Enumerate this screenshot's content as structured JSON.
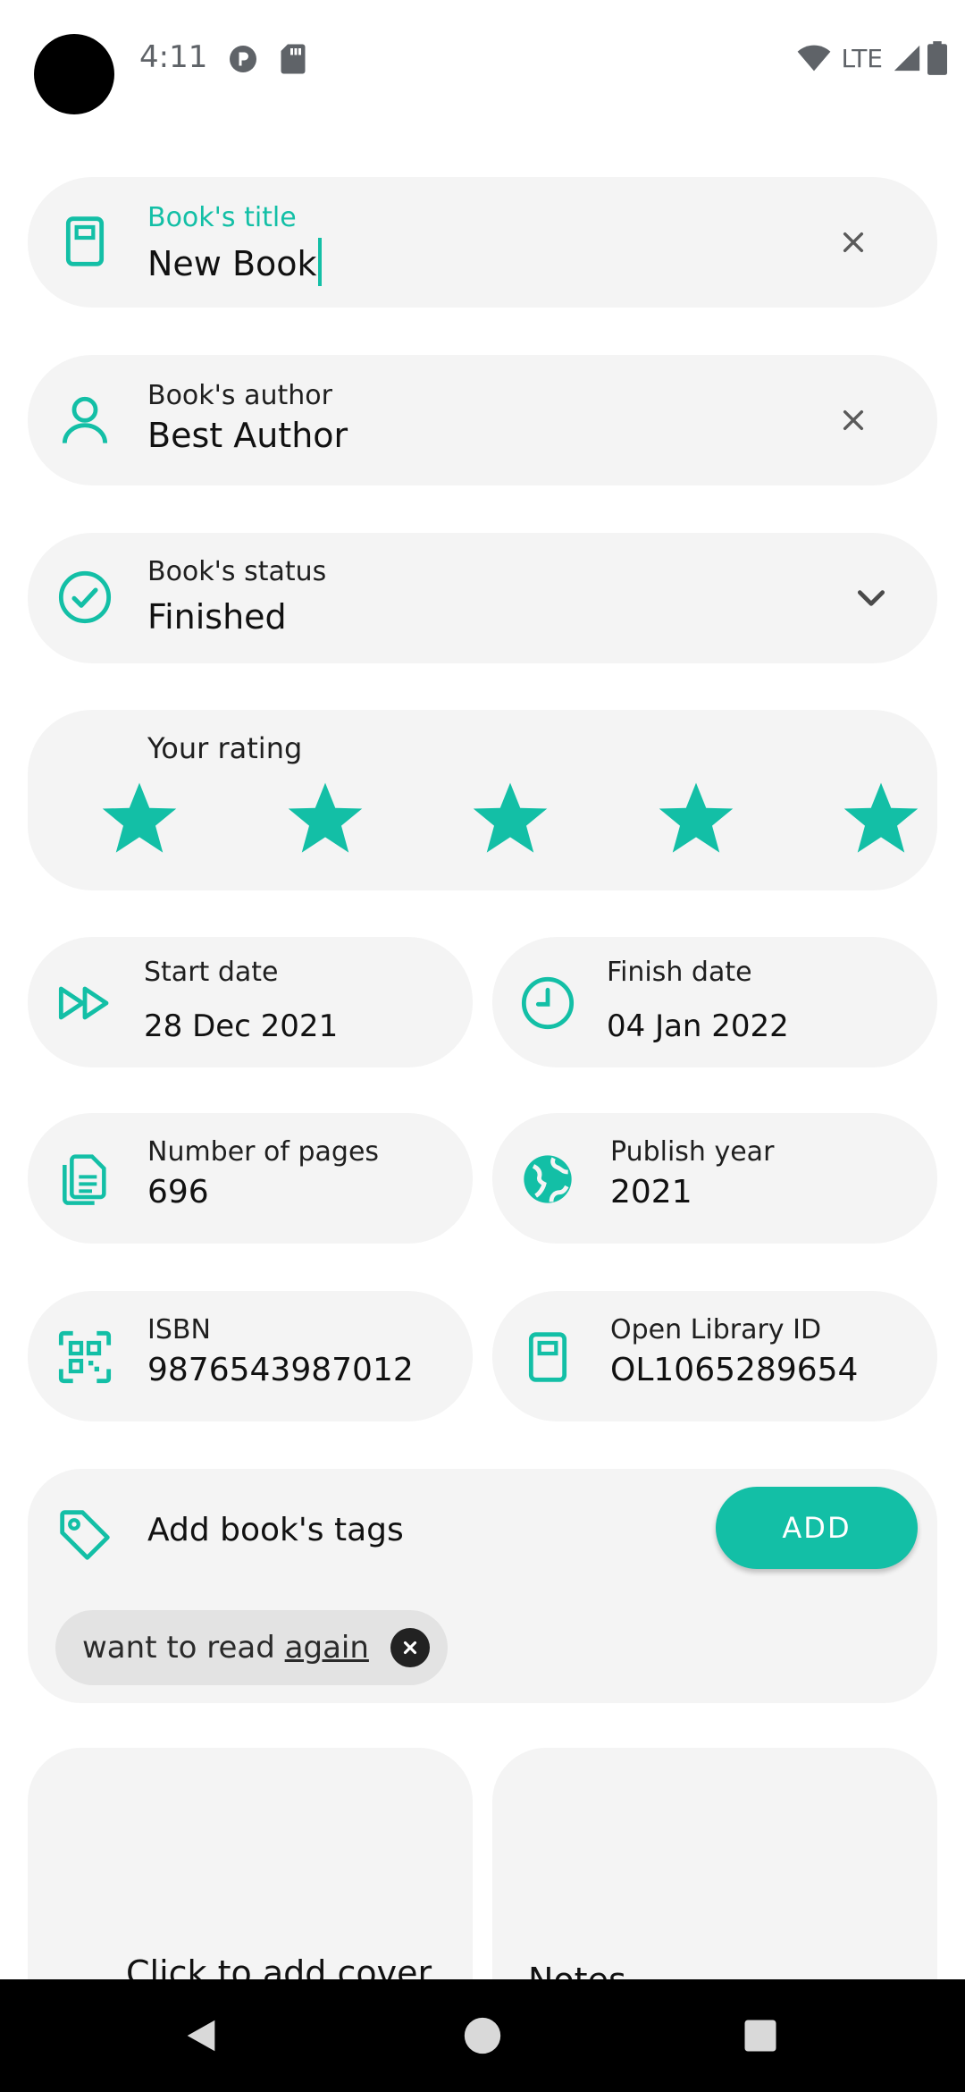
{
  "status_bar": {
    "time": "4:11",
    "network": "LTE",
    "icons": [
      "notification-icon",
      "sd-card-icon",
      "wifi-icon",
      "signal-icon",
      "battery-icon"
    ]
  },
  "colors": {
    "accent": "#13bfa6",
    "card": "#f4f4f4",
    "chip": "#e3e3e3"
  },
  "form": {
    "title": {
      "label": "Book's title",
      "value": "New Book",
      "icon": "book-icon",
      "clear_icon": "close-icon"
    },
    "author": {
      "label": "Book's author",
      "value": "Best Author",
      "icon": "person-icon",
      "clear_icon": "close-icon"
    },
    "status": {
      "label": "Book's status",
      "value": "Finished",
      "icon": "check-circle-icon",
      "dropdown_icon": "chevron-down-icon"
    },
    "rating": {
      "label": "Your rating",
      "value": 5,
      "max": 5,
      "icon": "star-icon"
    },
    "start_date": {
      "label": "Start date",
      "value": "28 Dec 2021",
      "icon": "fast-forward-icon"
    },
    "finish_date": {
      "label": "Finish date",
      "value": "04 Jan 2022",
      "icon": "clock-icon"
    },
    "pages": {
      "label": "Number of pages",
      "value": "696",
      "icon": "pages-icon"
    },
    "publish_year": {
      "label": "Publish year",
      "value": "2021",
      "icon": "globe-icon"
    },
    "isbn": {
      "label": "ISBN",
      "value": "9876543987012",
      "icon": "qr-code-icon"
    },
    "olid": {
      "label": "Open Library ID",
      "value": "OL1065289654",
      "icon": "book-icon"
    },
    "tags": {
      "label": "Add book's tags",
      "add_button": "ADD",
      "icon": "tag-icon",
      "items": [
        {
          "text_plain": "want to read ",
          "text_underlined": "again"
        }
      ]
    },
    "cover": {
      "label": "Click to add cover"
    },
    "notes": {
      "label": "Notes"
    }
  },
  "nav_bar": {
    "icons": [
      "back-icon",
      "home-icon",
      "recents-icon"
    ]
  }
}
